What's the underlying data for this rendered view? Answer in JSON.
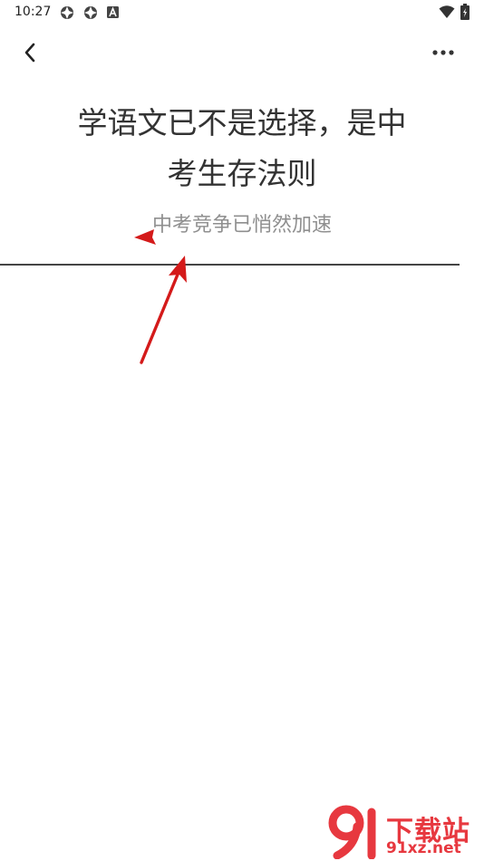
{
  "status_bar": {
    "time": "10:27"
  },
  "article": {
    "title_line1": "学语文已不是选择，是中",
    "title_line2": "考生存法则",
    "subtitle": "中考竞争已悄然加速"
  },
  "watermark": {
    "brand": "下载站",
    "url": "91xz.net"
  },
  "colors": {
    "annotation_arrow": "#d41a1a",
    "watermark": "#e7383f"
  }
}
